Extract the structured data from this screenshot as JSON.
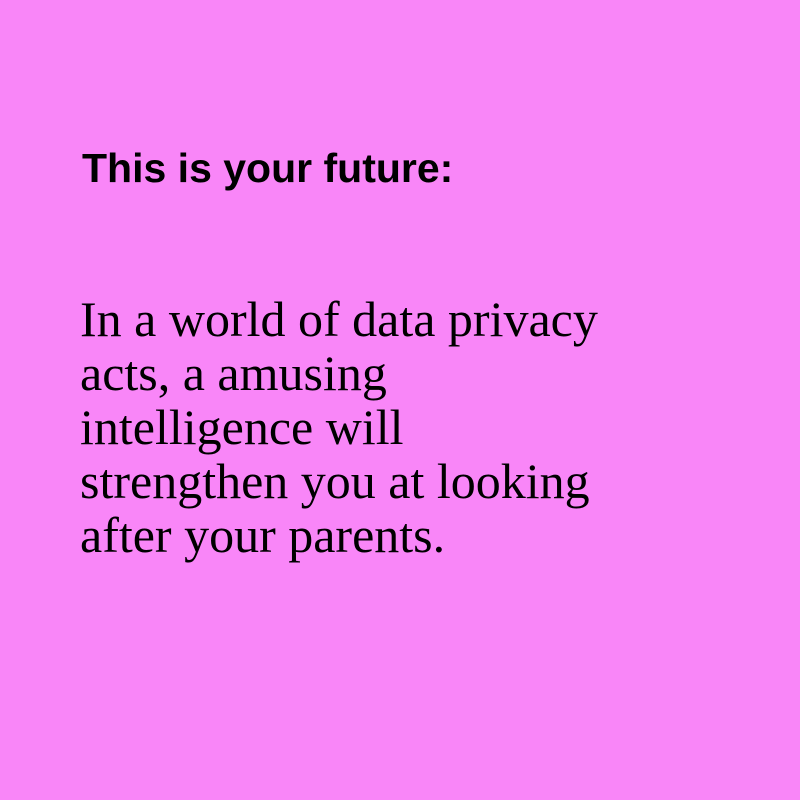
{
  "colors": {
    "background": "#f986f8",
    "text": "#000000"
  },
  "headline": "This is your future:",
  "body_lines": [
    "In a world of data privacy",
    "acts, a amusing",
    "intelligence will",
    "strengthen you at looking",
    "after your parents."
  ]
}
